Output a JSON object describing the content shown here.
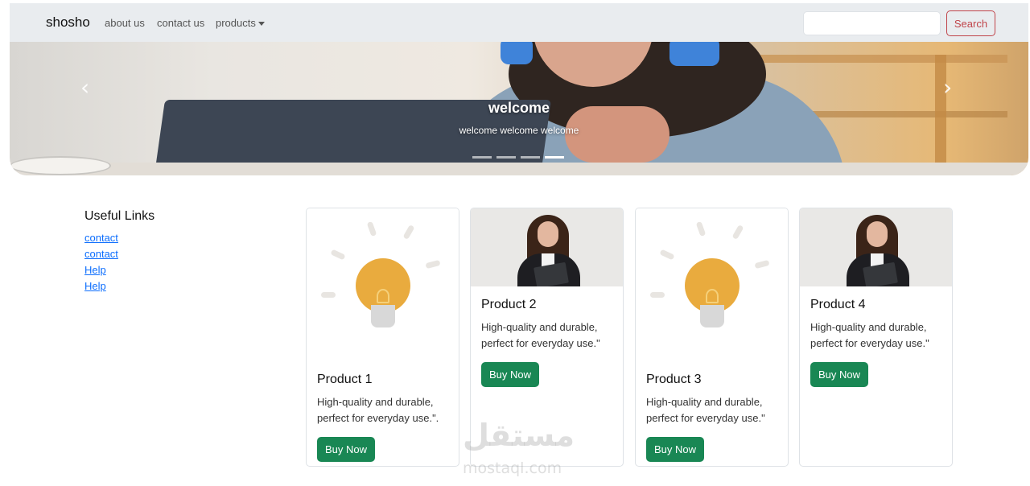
{
  "navbar": {
    "brand": "shosho",
    "links": [
      "about us",
      "contact us",
      "products"
    ],
    "search_placeholder": "",
    "search_button": "Search"
  },
  "carousel": {
    "title": "welcome",
    "subtitle": "welcome welcome welcome",
    "prev_icon": "‹",
    "next_icon": "›",
    "indicator_count": 4,
    "active_indicator": 4
  },
  "useful_links": {
    "title": "Useful Links",
    "items": [
      "contact",
      "contact",
      "Help",
      "Help"
    ]
  },
  "products": [
    {
      "title": "Product 1",
      "text": "High-quality and durable, perfect for everyday use.\".",
      "button": "Buy Now",
      "image": "lightbulb-image"
    },
    {
      "title": "Product 2",
      "text": "High-quality and durable, perfect for everyday use.\"",
      "button": "Buy Now",
      "image": "woman-image"
    },
    {
      "title": "Product 3",
      "text": "High-quality and durable, perfect for everyday use.\"",
      "button": "Buy Now",
      "image": "lightbulb-image"
    },
    {
      "title": "Product 4",
      "text": "High-quality and durable, perfect for everyday use.\"",
      "button": "Buy Now",
      "image": "woman-image"
    }
  ],
  "watermark": {
    "logo": "مستقل",
    "text": "mostaql.com"
  },
  "colors": {
    "navbar_bg": "#e9ecef",
    "search_accent": "#c0444a",
    "buy_button": "#198754",
    "link": "#0d6efd"
  }
}
